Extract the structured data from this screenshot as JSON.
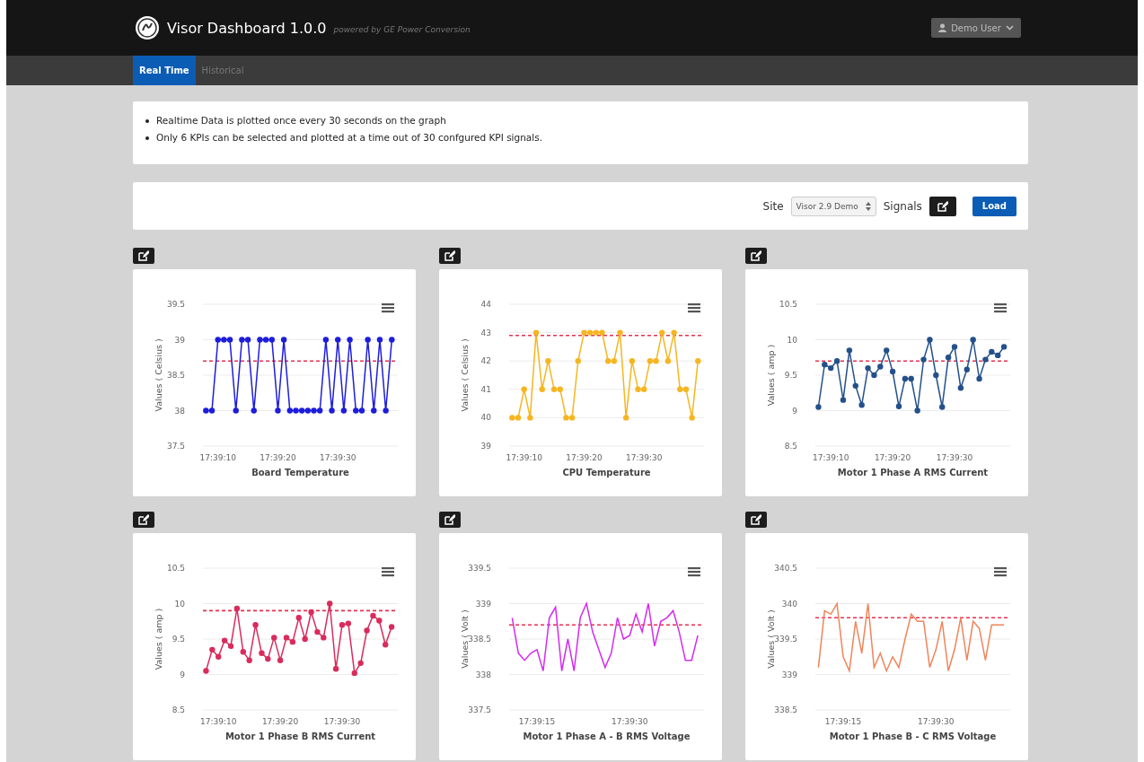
{
  "header": {
    "title": "Visor Dashboard 1.0.0",
    "subtitle": "powered by GE Power Conversion",
    "user": "Demo User"
  },
  "tabs": [
    {
      "label": "Real Time",
      "selected": true
    },
    {
      "label": "Historical",
      "selected": false
    }
  ],
  "notes": [
    "Realtime Data is plotted once every 30 seconds on the graph",
    "Only 6 KPIs can be selected and plotted at a time out of 30 confgured KPI signals."
  ],
  "toolbar": {
    "site_label": "Site",
    "site_value": "Visor 2.9 Demo",
    "signals_label": "Signals",
    "load_button": "Load"
  },
  "panels": [
    {
      "chart_data": {
        "type": "line",
        "title": "Board Temperature",
        "ylabel": "Values ( Celsius )",
        "grid": true,
        "categories": [
          null,
          null,
          "17:39:10",
          null,
          null,
          null,
          null,
          null,
          null,
          null,
          null,
          null,
          "17:39:20",
          null,
          null,
          null,
          null,
          null,
          null,
          null,
          null,
          null,
          "17:39:30",
          null,
          null,
          null,
          null,
          null,
          null,
          null,
          null,
          null
        ],
        "series": [
          {
            "color": "#1d1ddb",
            "marker": true,
            "values": [
              38,
              38,
              39,
              39,
              39,
              38,
              39,
              39,
              38,
              39,
              39,
              39,
              38,
              39,
              38,
              38,
              38,
              38,
              38,
              38,
              39,
              38,
              39,
              38,
              39,
              38,
              38,
              39,
              38,
              39,
              38,
              39
            ]
          }
        ],
        "ylim": [
          37.5,
          39.5
        ],
        "yticks": [
          37.5,
          38,
          38.5,
          39,
          39.5
        ],
        "ref_lines": [
          {
            "axis": "y",
            "value": 38.7,
            "color": "#e8304f"
          }
        ]
      }
    },
    {
      "chart_data": {
        "type": "line",
        "title": "CPU Temperature",
        "ylabel": "Values ( Celsius )",
        "grid": true,
        "categories": [
          null,
          null,
          "17:39:10",
          null,
          null,
          null,
          null,
          null,
          null,
          null,
          null,
          null,
          "17:39:20",
          null,
          null,
          null,
          null,
          null,
          null,
          null,
          null,
          null,
          "17:39:30",
          null,
          null,
          null,
          null,
          null,
          null,
          null,
          null,
          null
        ],
        "series": [
          {
            "color": "#f5b622",
            "marker": true,
            "values": [
              40,
              40,
              41,
              40,
              43,
              41,
              42,
              41,
              41,
              40,
              40,
              42,
              43,
              43,
              43,
              43,
              42,
              42,
              43,
              40,
              42,
              41,
              41,
              42,
              42,
              43,
              42,
              43,
              41,
              41,
              40,
              42
            ]
          }
        ],
        "ylim": [
          39,
          44
        ],
        "yticks": [
          39,
          40,
          41,
          42,
          43,
          44
        ],
        "ref_lines": [
          {
            "axis": "y",
            "value": 42.9,
            "color": "#e8304f"
          }
        ]
      }
    },
    {
      "chart_data": {
        "type": "line",
        "title": "Motor 1 Phase A RMS Current",
        "ylabel": "Values ( amp )",
        "grid": true,
        "categories": [
          null,
          null,
          "17:39:10",
          null,
          null,
          null,
          null,
          null,
          null,
          null,
          null,
          null,
          "17:39:20",
          null,
          null,
          null,
          null,
          null,
          null,
          null,
          null,
          null,
          "17:39:30",
          null,
          null,
          null,
          null,
          null,
          null,
          null,
          null
        ],
        "series": [
          {
            "color": "#24508a",
            "marker": true,
            "values": [
              9.05,
              9.65,
              9.6,
              9.7,
              9.15,
              9.85,
              9.35,
              9.08,
              9.6,
              9.5,
              9.62,
              9.85,
              9.55,
              9.06,
              9.45,
              9.45,
              9.0,
              9.72,
              10.0,
              9.5,
              9.05,
              9.75,
              9.9,
              9.32,
              9.58,
              10.0,
              9.45,
              9.72,
              9.83,
              9.78,
              9.9
            ]
          }
        ],
        "ylim": [
          8.5,
          10.5
        ],
        "yticks": [
          8.5,
          9,
          9.5,
          10,
          10.5
        ],
        "ref_lines": [
          {
            "axis": "y",
            "value": 9.7,
            "color": "#e8304f"
          }
        ]
      }
    },
    {
      "chart_data": {
        "type": "line",
        "title": "Motor 1 Phase B RMS Current",
        "ylabel": "Values ( amp )",
        "grid": true,
        "categories": [
          null,
          null,
          "17:39:10",
          null,
          null,
          null,
          null,
          null,
          null,
          null,
          null,
          null,
          "17:39:20",
          null,
          null,
          null,
          null,
          null,
          null,
          null,
          null,
          null,
          "17:39:30",
          null,
          null,
          null,
          null,
          null,
          null,
          null,
          null
        ],
        "series": [
          {
            "color": "#d92b5c",
            "marker": true,
            "values": [
              9.05,
              9.35,
              9.25,
              9.48,
              9.4,
              9.93,
              9.32,
              9.2,
              9.7,
              9.3,
              9.22,
              9.52,
              9.2,
              9.52,
              9.46,
              9.8,
              9.5,
              9.88,
              9.6,
              9.52,
              10.0,
              9.08,
              9.7,
              9.72,
              9.02,
              9.16,
              9.62,
              9.83,
              9.76,
              9.42,
              9.67
            ]
          }
        ],
        "ylim": [
          8.5,
          10.5
        ],
        "yticks": [
          8.5,
          9,
          9.5,
          10,
          10.5
        ],
        "ref_lines": [
          {
            "axis": "y",
            "value": 9.9,
            "color": "#e8304f"
          }
        ]
      }
    },
    {
      "chart_data": {
        "type": "line",
        "title": "Motor 1 Phase A - B RMS Voltage",
        "ylabel": "Values ( Volt )",
        "grid": true,
        "categories": [
          null,
          null,
          null,
          null,
          "17:39:15",
          null,
          null,
          null,
          null,
          null,
          null,
          null,
          null,
          null,
          null,
          null,
          null,
          null,
          null,
          "17:39:30",
          null,
          null,
          null,
          null,
          null,
          null,
          null,
          null,
          null,
          null,
          null
        ],
        "series": [
          {
            "color": "#d42bf0",
            "marker": false,
            "values": [
              338.8,
              338.3,
              338.2,
              338.3,
              338.35,
              338.05,
              338.8,
              338.95,
              338.05,
              338.5,
              338.05,
              338.8,
              339.0,
              338.6,
              338.35,
              338.1,
              338.3,
              338.8,
              338.5,
              338.55,
              338.85,
              338.6,
              339.0,
              338.4,
              338.75,
              338.8,
              338.9,
              338.6,
              338.2,
              338.2,
              338.55
            ]
          }
        ],
        "ylim": [
          337.5,
          339.5
        ],
        "yticks": [
          337.5,
          338,
          338.5,
          339,
          339.5
        ],
        "ref_lines": [
          {
            "axis": "y",
            "value": 338.7,
            "color": "#e8304f"
          }
        ]
      }
    },
    {
      "chart_data": {
        "type": "line",
        "title": "Motor 1 Phase B - C RMS Voltage",
        "ylabel": "Values ( Volt )",
        "grid": true,
        "categories": [
          null,
          null,
          null,
          null,
          "17:39:15",
          null,
          null,
          null,
          null,
          null,
          null,
          null,
          null,
          null,
          null,
          null,
          null,
          null,
          null,
          "17:39:30",
          null,
          null,
          null,
          null,
          null,
          null,
          null,
          null,
          null,
          null,
          null
        ],
        "series": [
          {
            "color": "#f0845a",
            "marker": false,
            "values": [
              339.1,
              339.9,
              339.85,
              340.0,
              339.25,
              339.05,
              339.75,
              339.3,
              340.0,
              339.1,
              339.3,
              339.05,
              339.25,
              339.1,
              339.5,
              339.85,
              339.75,
              339.75,
              339.1,
              339.35,
              339.75,
              339.05,
              339.35,
              339.8,
              339.2,
              339.75,
              339.65,
              339.2,
              339.7,
              339.7,
              339.7
            ]
          }
        ],
        "ylim": [
          338.5,
          340.5
        ],
        "yticks": [
          338.5,
          339,
          339.5,
          340,
          340.5
        ],
        "ref_lines": [
          {
            "axis": "y",
            "value": 339.8,
            "color": "#e8304f"
          }
        ]
      }
    }
  ]
}
